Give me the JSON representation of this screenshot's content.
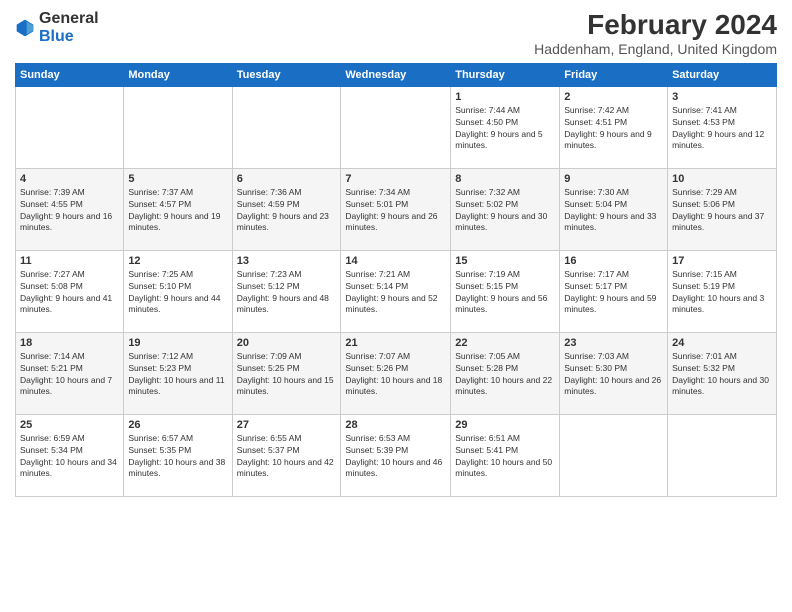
{
  "logo": {
    "general": "General",
    "blue": "Blue"
  },
  "title": "February 2024",
  "subtitle": "Haddenham, England, United Kingdom",
  "headers": [
    "Sunday",
    "Monday",
    "Tuesday",
    "Wednesday",
    "Thursday",
    "Friday",
    "Saturday"
  ],
  "weeks": [
    [
      {
        "day": "",
        "sunrise": "",
        "sunset": "",
        "daylight": ""
      },
      {
        "day": "",
        "sunrise": "",
        "sunset": "",
        "daylight": ""
      },
      {
        "day": "",
        "sunrise": "",
        "sunset": "",
        "daylight": ""
      },
      {
        "day": "",
        "sunrise": "",
        "sunset": "",
        "daylight": ""
      },
      {
        "day": "1",
        "sunrise": "Sunrise: 7:44 AM",
        "sunset": "Sunset: 4:50 PM",
        "daylight": "Daylight: 9 hours and 5 minutes."
      },
      {
        "day": "2",
        "sunrise": "Sunrise: 7:42 AM",
        "sunset": "Sunset: 4:51 PM",
        "daylight": "Daylight: 9 hours and 9 minutes."
      },
      {
        "day": "3",
        "sunrise": "Sunrise: 7:41 AM",
        "sunset": "Sunset: 4:53 PM",
        "daylight": "Daylight: 9 hours and 12 minutes."
      }
    ],
    [
      {
        "day": "4",
        "sunrise": "Sunrise: 7:39 AM",
        "sunset": "Sunset: 4:55 PM",
        "daylight": "Daylight: 9 hours and 16 minutes."
      },
      {
        "day": "5",
        "sunrise": "Sunrise: 7:37 AM",
        "sunset": "Sunset: 4:57 PM",
        "daylight": "Daylight: 9 hours and 19 minutes."
      },
      {
        "day": "6",
        "sunrise": "Sunrise: 7:36 AM",
        "sunset": "Sunset: 4:59 PM",
        "daylight": "Daylight: 9 hours and 23 minutes."
      },
      {
        "day": "7",
        "sunrise": "Sunrise: 7:34 AM",
        "sunset": "Sunset: 5:01 PM",
        "daylight": "Daylight: 9 hours and 26 minutes."
      },
      {
        "day": "8",
        "sunrise": "Sunrise: 7:32 AM",
        "sunset": "Sunset: 5:02 PM",
        "daylight": "Daylight: 9 hours and 30 minutes."
      },
      {
        "day": "9",
        "sunrise": "Sunrise: 7:30 AM",
        "sunset": "Sunset: 5:04 PM",
        "daylight": "Daylight: 9 hours and 33 minutes."
      },
      {
        "day": "10",
        "sunrise": "Sunrise: 7:29 AM",
        "sunset": "Sunset: 5:06 PM",
        "daylight": "Daylight: 9 hours and 37 minutes."
      }
    ],
    [
      {
        "day": "11",
        "sunrise": "Sunrise: 7:27 AM",
        "sunset": "Sunset: 5:08 PM",
        "daylight": "Daylight: 9 hours and 41 minutes."
      },
      {
        "day": "12",
        "sunrise": "Sunrise: 7:25 AM",
        "sunset": "Sunset: 5:10 PM",
        "daylight": "Daylight: 9 hours and 44 minutes."
      },
      {
        "day": "13",
        "sunrise": "Sunrise: 7:23 AM",
        "sunset": "Sunset: 5:12 PM",
        "daylight": "Daylight: 9 hours and 48 minutes."
      },
      {
        "day": "14",
        "sunrise": "Sunrise: 7:21 AM",
        "sunset": "Sunset: 5:14 PM",
        "daylight": "Daylight: 9 hours and 52 minutes."
      },
      {
        "day": "15",
        "sunrise": "Sunrise: 7:19 AM",
        "sunset": "Sunset: 5:15 PM",
        "daylight": "Daylight: 9 hours and 56 minutes."
      },
      {
        "day": "16",
        "sunrise": "Sunrise: 7:17 AM",
        "sunset": "Sunset: 5:17 PM",
        "daylight": "Daylight: 9 hours and 59 minutes."
      },
      {
        "day": "17",
        "sunrise": "Sunrise: 7:15 AM",
        "sunset": "Sunset: 5:19 PM",
        "daylight": "Daylight: 10 hours and 3 minutes."
      }
    ],
    [
      {
        "day": "18",
        "sunrise": "Sunrise: 7:14 AM",
        "sunset": "Sunset: 5:21 PM",
        "daylight": "Daylight: 10 hours and 7 minutes."
      },
      {
        "day": "19",
        "sunrise": "Sunrise: 7:12 AM",
        "sunset": "Sunset: 5:23 PM",
        "daylight": "Daylight: 10 hours and 11 minutes."
      },
      {
        "day": "20",
        "sunrise": "Sunrise: 7:09 AM",
        "sunset": "Sunset: 5:25 PM",
        "daylight": "Daylight: 10 hours and 15 minutes."
      },
      {
        "day": "21",
        "sunrise": "Sunrise: 7:07 AM",
        "sunset": "Sunset: 5:26 PM",
        "daylight": "Daylight: 10 hours and 18 minutes."
      },
      {
        "day": "22",
        "sunrise": "Sunrise: 7:05 AM",
        "sunset": "Sunset: 5:28 PM",
        "daylight": "Daylight: 10 hours and 22 minutes."
      },
      {
        "day": "23",
        "sunrise": "Sunrise: 7:03 AM",
        "sunset": "Sunset: 5:30 PM",
        "daylight": "Daylight: 10 hours and 26 minutes."
      },
      {
        "day": "24",
        "sunrise": "Sunrise: 7:01 AM",
        "sunset": "Sunset: 5:32 PM",
        "daylight": "Daylight: 10 hours and 30 minutes."
      }
    ],
    [
      {
        "day": "25",
        "sunrise": "Sunrise: 6:59 AM",
        "sunset": "Sunset: 5:34 PM",
        "daylight": "Daylight: 10 hours and 34 minutes."
      },
      {
        "day": "26",
        "sunrise": "Sunrise: 6:57 AM",
        "sunset": "Sunset: 5:35 PM",
        "daylight": "Daylight: 10 hours and 38 minutes."
      },
      {
        "day": "27",
        "sunrise": "Sunrise: 6:55 AM",
        "sunset": "Sunset: 5:37 PM",
        "daylight": "Daylight: 10 hours and 42 minutes."
      },
      {
        "day": "28",
        "sunrise": "Sunrise: 6:53 AM",
        "sunset": "Sunset: 5:39 PM",
        "daylight": "Daylight: 10 hours and 46 minutes."
      },
      {
        "day": "29",
        "sunrise": "Sunrise: 6:51 AM",
        "sunset": "Sunset: 5:41 PM",
        "daylight": "Daylight: 10 hours and 50 minutes."
      },
      {
        "day": "",
        "sunrise": "",
        "sunset": "",
        "daylight": ""
      },
      {
        "day": "",
        "sunrise": "",
        "sunset": "",
        "daylight": ""
      }
    ]
  ]
}
